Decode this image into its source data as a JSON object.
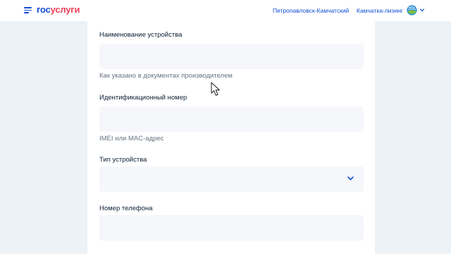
{
  "header": {
    "logo_part1": "гос",
    "logo_part2": "услуги",
    "location": "Петропавловск-Камчатский",
    "organization": "Камчатка-лизинг",
    "brand_blue": "#0d4cd3",
    "brand_red": "#ee3f58"
  },
  "form": {
    "device_name": {
      "label": "Наименование устройства",
      "value": "",
      "hint": "Как указано в документах производителем"
    },
    "device_id": {
      "label": "Идентификационный номер",
      "value": "",
      "hint": "IMEI или MAC-адрес"
    },
    "device_type": {
      "label": "Тип устройства",
      "selected": ""
    },
    "phone": {
      "label": "Номер телефона",
      "value": ""
    }
  },
  "icons": {
    "menu": "hamburger-menu-icon",
    "avatar": "globe-avatar-icon",
    "chevron": "chevron-down-icon",
    "cursor": "mouse-cursor-icon"
  }
}
